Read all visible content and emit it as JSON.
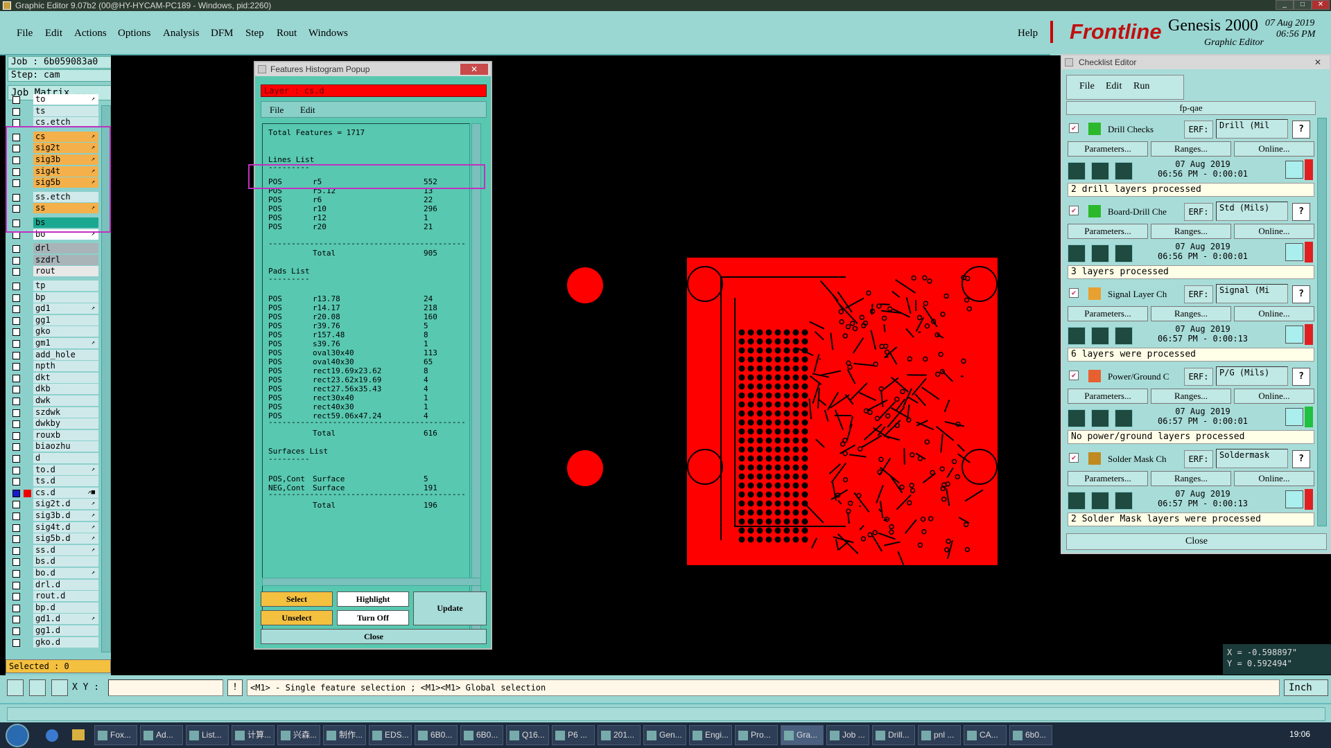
{
  "window": {
    "title": "Graphic Editor 9.07b2 (00@HY-HYCAM-PC189 - Windows, pid:2260)"
  },
  "menu": {
    "items": [
      "File",
      "Edit",
      "Actions",
      "Options",
      "Analysis",
      "DFM",
      "Step",
      "Rout",
      "Windows"
    ],
    "help": "Help"
  },
  "brand": {
    "logo": "Frontline",
    "product": "Genesis 2000",
    "subtitle": "Graphic Editor",
    "date": "07 Aug 2019",
    "time": "06:56 PM"
  },
  "job": {
    "job_label": "Job : 6b059083a0",
    "step_label": "Step: cam",
    "matrix_button": "Job Matrix ..."
  },
  "layers": [
    {
      "name": "to",
      "color": "#ffffff",
      "mark": "↗"
    },
    {
      "name": "ts",
      "color": "#cfe9ea",
      "mark": ""
    },
    {
      "name": "cs.etch",
      "color": "#cfe9ea",
      "mark": ""
    },
    {
      "name": "cs",
      "color": "#f4b04a",
      "mark": "↗"
    },
    {
      "name": "sig2t",
      "color": "#f4b04a",
      "mark": "↗"
    },
    {
      "name": "sig3b",
      "color": "#f4b04a",
      "mark": "↗"
    },
    {
      "name": "sig4t",
      "color": "#f4b04a",
      "mark": "↗"
    },
    {
      "name": "sig5b",
      "color": "#f4b04a",
      "mark": "↗"
    },
    {
      "name": "ss.etch",
      "color": "#cfe9ea",
      "mark": ""
    },
    {
      "name": "ss",
      "color": "#f4b04a",
      "mark": "↗"
    },
    {
      "name": "bs",
      "color": "#1aa890",
      "mark": ""
    },
    {
      "name": "bo",
      "color": "#ffffff",
      "mark": "↗"
    },
    {
      "name": "drl",
      "color": "#a8b4b8",
      "mark": ""
    },
    {
      "name": "szdrl",
      "color": "#a8b4b8",
      "mark": ""
    },
    {
      "name": "rout",
      "color": "#e8e8e8",
      "mark": ""
    },
    {
      "name": "tp",
      "color": "#cfe9ea",
      "mark": ""
    },
    {
      "name": "bp",
      "color": "#cfe9ea",
      "mark": ""
    },
    {
      "name": "gd1",
      "color": "#cfe9ea",
      "mark": "↗"
    },
    {
      "name": "gg1",
      "color": "#cfe9ea",
      "mark": ""
    },
    {
      "name": "gko",
      "color": "#cfe9ea",
      "mark": ""
    },
    {
      "name": "gm1",
      "color": "#cfe9ea",
      "mark": "↗"
    },
    {
      "name": "add_hole",
      "color": "#cfe9ea",
      "mark": ""
    },
    {
      "name": "npth",
      "color": "#cfe9ea",
      "mark": ""
    },
    {
      "name": "dkt",
      "color": "#cfe9ea",
      "mark": ""
    },
    {
      "name": "dkb",
      "color": "#cfe9ea",
      "mark": ""
    },
    {
      "name": "dwk",
      "color": "#cfe9ea",
      "mark": ""
    },
    {
      "name": "szdwk",
      "color": "#cfe9ea",
      "mark": ""
    },
    {
      "name": "dwkby",
      "color": "#cfe9ea",
      "mark": ""
    },
    {
      "name": "rouxb",
      "color": "#cfe9ea",
      "mark": ""
    },
    {
      "name": "biaozhu",
      "color": "#cfe9ea",
      "mark": ""
    },
    {
      "name": "d",
      "color": "#cfe9ea",
      "mark": ""
    },
    {
      "name": "to.d",
      "color": "#cfe9ea",
      "mark": "↗"
    },
    {
      "name": "ts.d",
      "color": "#cfe9ea",
      "mark": ""
    },
    {
      "name": "cs.d",
      "color": "#cfe9ea",
      "mark": "↗■"
    },
    {
      "name": "sig2t.d",
      "color": "#cfe9ea",
      "mark": "↗"
    },
    {
      "name": "sig3b.d",
      "color": "#cfe9ea",
      "mark": "↗"
    },
    {
      "name": "sig4t.d",
      "color": "#cfe9ea",
      "mark": "↗"
    },
    {
      "name": "sig5b.d",
      "color": "#cfe9ea",
      "mark": "↗"
    },
    {
      "name": "ss.d",
      "color": "#cfe9ea",
      "mark": "↗"
    },
    {
      "name": "bs.d",
      "color": "#cfe9ea",
      "mark": ""
    },
    {
      "name": "bo.d",
      "color": "#cfe9ea",
      "mark": "↗"
    },
    {
      "name": "drl.d",
      "color": "#cfe9ea",
      "mark": ""
    },
    {
      "name": "rout.d",
      "color": "#cfe9ea",
      "mark": ""
    },
    {
      "name": "bp.d",
      "color": "#cfe9ea",
      "mark": ""
    },
    {
      "name": "gd1.d",
      "color": "#cfe9ea",
      "mark": "↗"
    },
    {
      "name": "gg1.d",
      "color": "#cfe9ea",
      "mark": ""
    },
    {
      "name": "gko.d",
      "color": "#cfe9ea",
      "mark": ""
    }
  ],
  "selected": "Selected : 0",
  "histogram": {
    "title": "Features Histogram Popup",
    "layer": "Layer :  cs.d",
    "menu": [
      "File",
      "Edit"
    ],
    "total_features": "Total Features = 1717",
    "lines_header": "Lines List",
    "lines": [
      {
        "pol": "POS",
        "sym": "r5",
        "count": "552"
      },
      {
        "pol": "POS",
        "sym": "r5.12",
        "count": "13"
      },
      {
        "pol": "POS",
        "sym": "r6",
        "count": "22"
      },
      {
        "pol": "POS",
        "sym": "r10",
        "count": "296"
      },
      {
        "pol": "POS",
        "sym": "r12",
        "count": "1"
      },
      {
        "pol": "POS",
        "sym": "r20",
        "count": "21"
      }
    ],
    "lines_total": "905",
    "pads_header": "Pads List",
    "pads": [
      {
        "pol": "POS",
        "sym": "r13.78",
        "count": "24"
      },
      {
        "pol": "POS",
        "sym": "r14.17",
        "count": "218"
      },
      {
        "pol": "POS",
        "sym": "r20.08",
        "count": "160"
      },
      {
        "pol": "POS",
        "sym": "r39.76",
        "count": "5"
      },
      {
        "pol": "POS",
        "sym": "r157.48",
        "count": "8"
      },
      {
        "pol": "POS",
        "sym": "s39.76",
        "count": "1"
      },
      {
        "pol": "POS",
        "sym": "oval30x40",
        "count": "113"
      },
      {
        "pol": "POS",
        "sym": "oval40x30",
        "count": "65"
      },
      {
        "pol": "POS",
        "sym": "rect19.69x23.62",
        "count": "8"
      },
      {
        "pol": "POS",
        "sym": "rect23.62x19.69",
        "count": "4"
      },
      {
        "pol": "POS",
        "sym": "rect27.56x35.43",
        "count": "4"
      },
      {
        "pol": "POS",
        "sym": "rect30x40",
        "count": "1"
      },
      {
        "pol": "POS",
        "sym": "rect40x30",
        "count": "1"
      },
      {
        "pol": "POS",
        "sym": "rect59.06x47.24",
        "count": "4"
      }
    ],
    "pads_total": "616",
    "surfaces_header": "Surfaces List",
    "surfaces": [
      {
        "pol": "POS,Cont",
        "sym": "Surface",
        "count": "5"
      },
      {
        "pol": "NEG,Cont",
        "sym": "Surface",
        "count": "191"
      }
    ],
    "surfaces_total": "196",
    "total_label": "Total",
    "underline": "---------",
    "separator": "-------------------------------------------",
    "buttons": {
      "select": "Select",
      "highlight": "Highlight",
      "unselect": "Unselect",
      "turn_off": "Turn Off",
      "update": "Update",
      "close": "Close"
    }
  },
  "checklist": {
    "title": "Checklist Editor",
    "menu": [
      "File",
      "Edit",
      "Run"
    ],
    "name": "fp-qae",
    "items": [
      {
        "name": "Drill Checks",
        "erf": "ERF:",
        "value": "Drill (Mil",
        "params": "Parameters...",
        "ranges": "Ranges...",
        "online": "Online...",
        "date": "07 Aug 2019",
        "time": "06:56 PM - 0:00:01",
        "msg": "2 drill layers processed",
        "status": "#e02020",
        "icon": "#2bb82b"
      },
      {
        "name": "Board-Drill Che",
        "erf": "ERF:",
        "value": "Std (Mils)",
        "params": "Parameters...",
        "ranges": "Ranges...",
        "online": "Online...",
        "date": "07 Aug 2019",
        "time": "06:56 PM - 0:00:01",
        "msg": "3 layers processed",
        "status": "#e02020",
        "icon": "#2bb82b"
      },
      {
        "name": "Signal Layer Ch",
        "erf": "ERF:",
        "value": "Signal (Mi",
        "params": "Parameters...",
        "ranges": "Ranges...",
        "online": "Online...",
        "date": "07 Aug 2019",
        "time": "06:57 PM - 0:00:13",
        "msg": "6 layers were processed",
        "status": "#e02020",
        "icon": "#e8a030"
      },
      {
        "name": "Power/Ground C",
        "erf": "ERF:",
        "value": "P/G (Mils)",
        "params": "Parameters...",
        "ranges": "Ranges...",
        "online": "Online...",
        "date": "07 Aug 2019",
        "time": "06:57 PM - 0:00:01",
        "msg": "No power/ground layers processed",
        "status": "#20c040",
        "icon": "#e86030"
      },
      {
        "name": "Solder Mask Ch",
        "erf": "ERF:",
        "value": "Soldermask",
        "params": "Parameters...",
        "ranges": "Ranges...",
        "online": "Online...",
        "date": "07 Aug 2019",
        "time": "06:57 PM - 0:00:13",
        "msg": "2 Solder Mask layers were processed",
        "status": "#e02020",
        "icon": "#c08a20"
      }
    ],
    "close": "Close",
    "help": "?"
  },
  "coords": {
    "x": "X = -0.598897\"",
    "y": "Y = 0.592494\""
  },
  "status": {
    "xy_label": "X Y :",
    "xy_value": "",
    "message": "<M1> - Single feature selection ; <M1><M1> Global selection",
    "unit": "Inch"
  },
  "taskbar": {
    "items": [
      "Fox...",
      "Ad...",
      "List...",
      "计算...",
      "兴森...",
      "制作...",
      "EDS...",
      "6B0...",
      "6B0...",
      "Q16...",
      "P6 ...",
      "201...",
      "Gen...",
      "Engi...",
      "Pro...",
      "Gra...",
      "Job ...",
      "Drill...",
      "pnl ...",
      "CA...",
      "6b0..."
    ],
    "clock": "19:06"
  },
  "colors": {
    "panel": "#9ad6d2",
    "canvas": "#000000",
    "board": "#ff0000",
    "highlight_box": "#c030c0"
  }
}
